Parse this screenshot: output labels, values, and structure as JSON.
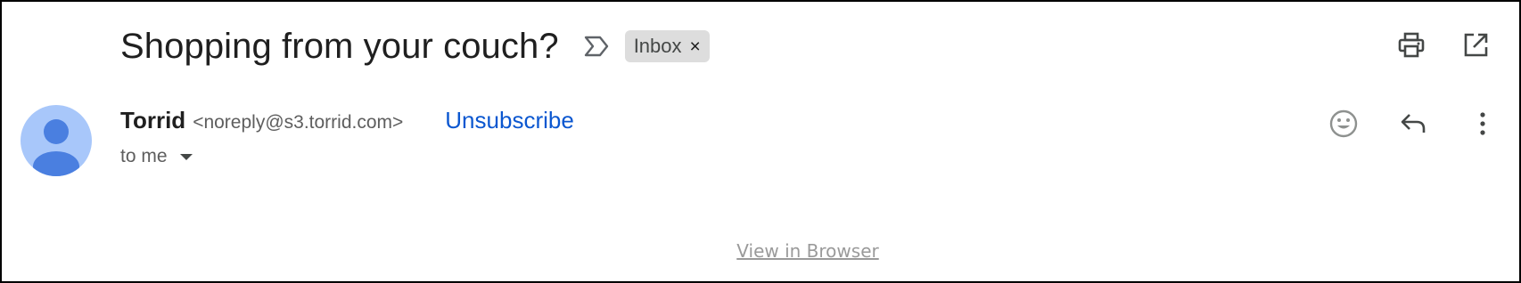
{
  "subject": {
    "title": "Shopping from your couch?",
    "importance_icon": "importance-marker-icon",
    "label": "Inbox",
    "label_remove": "×"
  },
  "toolbar": {
    "print_icon": "print-icon",
    "new_window_icon": "open-in-new-window-icon"
  },
  "message": {
    "sender_name": "Torrid",
    "sender_email": "<noreply@s3.torrid.com>",
    "unsubscribe_label": "Unsubscribe",
    "recipient": "to me",
    "avatar_icon": "default-avatar-icon",
    "actions": [
      "emoji-reaction-icon",
      "reply-icon",
      "more-options-icon"
    ]
  },
  "body": {
    "view_in_browser": "View in Browser"
  },
  "colors": {
    "link": "#0b57d0",
    "avatar_background": "#a8c7fa",
    "avatar_figure": "#4a7fe0",
    "chip_background": "#dddddd",
    "muted_text": "#5e5e5e"
  }
}
